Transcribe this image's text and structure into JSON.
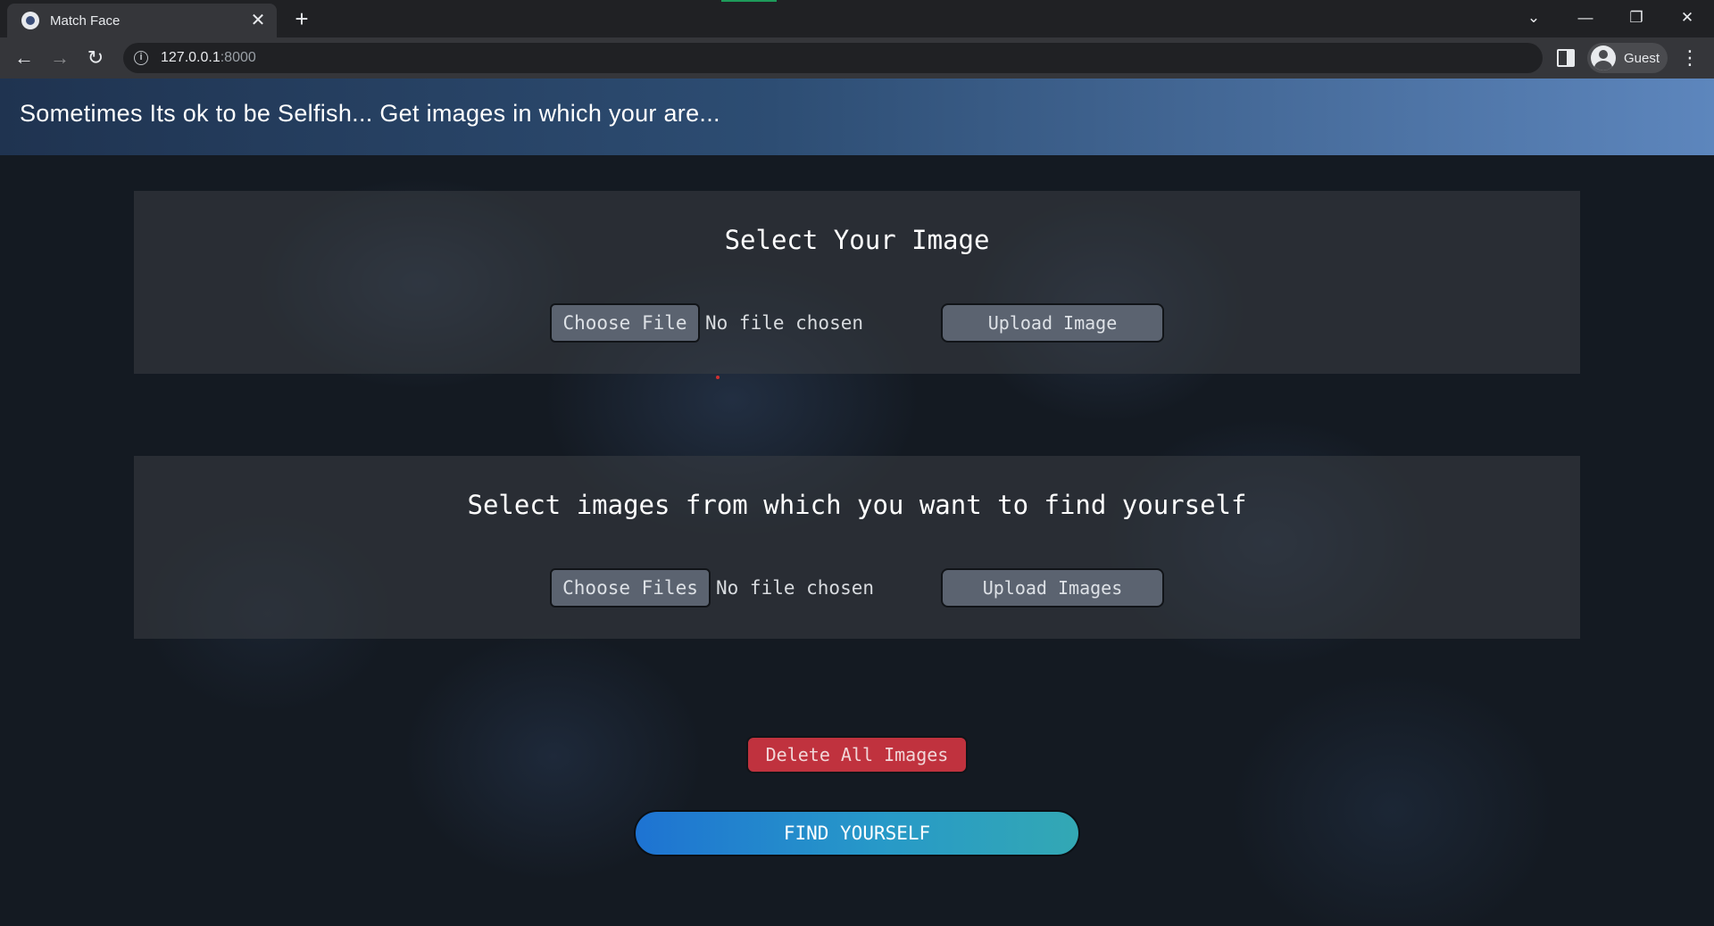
{
  "browser": {
    "tab": {
      "title": "Match Face",
      "favicon": "match-face-favicon",
      "close_glyph": "✕"
    },
    "new_tab_glyph": "+",
    "window_controls": {
      "tab_search_glyph": "⌄",
      "minimize_glyph": "—",
      "restore_glyph": "❐",
      "close_glyph": "✕"
    },
    "nav": {
      "back_glyph": "←",
      "forward_glyph": "→",
      "reload_glyph": "↻"
    },
    "address": {
      "host": "127.0.0.1",
      "port": ":8000",
      "info_glyph": "i"
    },
    "profile_label": "Guest",
    "menu_glyph": "⋮"
  },
  "page": {
    "header": {
      "title": "Sometimes Its ok to be Selfish... Get images in which your are..."
    },
    "single_upload": {
      "title": "Select Your Image",
      "choose_label": "Choose File",
      "file_status": "No file chosen",
      "upload_label": "Upload Image"
    },
    "multi_upload": {
      "title": "Select images from which you want to find yourself",
      "choose_label": "Choose Files",
      "file_status": "No file chosen",
      "upload_label": "Upload Images"
    },
    "delete_label": "Delete All Images",
    "find_label": "FIND YOURSELF"
  },
  "colors": {
    "header_gradient_start": "#1f3350",
    "header_gradient_end": "#5d86bd",
    "button_gray": "#5b6370",
    "delete_red": "#c0323e",
    "find_gradient_start": "#1e73d2",
    "find_gradient_end": "#33a8b4"
  }
}
